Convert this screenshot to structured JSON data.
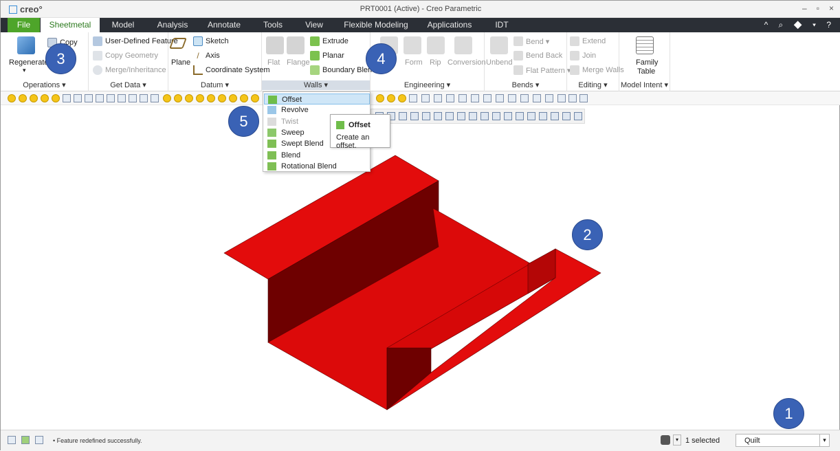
{
  "window": {
    "app_name": "creo°",
    "title": "PRT0001 (Active) - Creo Parametric",
    "controls": [
      "–",
      "▫",
      "×"
    ]
  },
  "tabs": [
    {
      "label": "File"
    },
    {
      "label": "Sheetmetal"
    },
    {
      "label": "Model"
    },
    {
      "label": "Analysis"
    },
    {
      "label": "Annotate"
    },
    {
      "label": "Tools"
    },
    {
      "label": "View"
    },
    {
      "label": "Flexible Modeling"
    },
    {
      "label": "Applications"
    },
    {
      "label": "IDT"
    }
  ],
  "tabbar_right_icons": "^ ⌕ ◆ ▾ ?",
  "ribbon": {
    "operations": {
      "regenerate": "Regenerate",
      "copy": "Copy",
      "label": "Operations ▾"
    },
    "get_data": {
      "user_defined_feature": "User-Defined Feature",
      "copy_geometry": "Copy Geometry",
      "merge_inheritance": "Merge/Inheritance",
      "label": "Get Data ▾"
    },
    "datum": {
      "plane": "Plane",
      "sketch": "Sketch",
      "axis": "Axis",
      "coordinate_system": "Coordinate System",
      "label": "Datum ▾"
    },
    "walls": {
      "flat": "Flat",
      "flange": "Flange",
      "extrude": "Extrude",
      "planar": "Planar",
      "boundary_blend": "Boundary Blend",
      "label": "Walls ▾"
    },
    "engineering": {
      "form": "Form",
      "rip": "Rip",
      "conversion": "Conversion",
      "label": "Engineering ▾"
    },
    "bends": {
      "unbend": "Unbend",
      "bend": "Bend ▾",
      "bend_back": "Bend Back",
      "flat_pattern": "Flat Pattern ▾",
      "label": "Bends ▾"
    },
    "editing": {
      "extend": "Extend",
      "join": "Join",
      "merge_walls": "Merge Walls",
      "label": "Editing ▾"
    },
    "model_intent": {
      "family_table_1": "Family",
      "family_table_2": "Table",
      "label": "Model Intent ▾"
    }
  },
  "walls_menu": {
    "items": [
      {
        "label": "Offset"
      },
      {
        "label": "Revolve"
      },
      {
        "label": "Twist"
      },
      {
        "label": "Sweep"
      },
      {
        "label": "Swept Blend"
      },
      {
        "label": "Blend"
      },
      {
        "label": "Rotational Blend"
      }
    ]
  },
  "tooltip": {
    "title": "Offset",
    "body": "Create an offset."
  },
  "callouts": [
    "1",
    "2",
    "3",
    "4",
    "5"
  ],
  "status": {
    "message": "• Feature redefined successfully.",
    "selected": "1 selected",
    "filter": "Quilt"
  },
  "colors": {
    "model_red": "#e30c0c",
    "model_dark": "#6e0000",
    "file_tab": "#4ea52a",
    "tab_bar": "#2b2f36",
    "callout": "#3a62b5"
  }
}
